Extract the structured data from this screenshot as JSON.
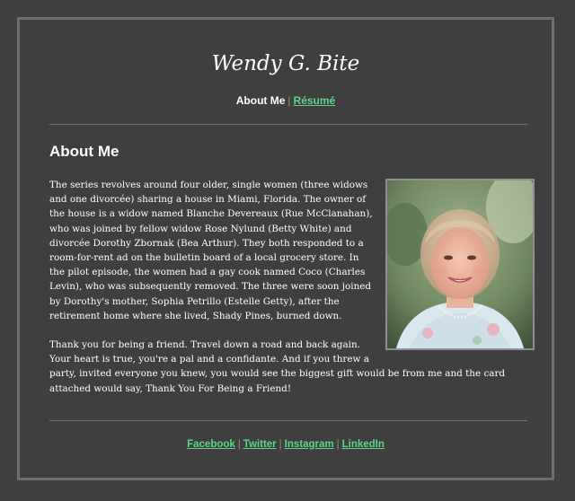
{
  "site": {
    "title": "Wendy G. Bite"
  },
  "nav": {
    "current": "About Me",
    "separator": "|",
    "resume_label": "Résumé"
  },
  "main": {
    "heading": "About Me",
    "paragraph_1": "The series revolves around four older, single women (three widows and one divorcée) sharing a house in Miami, Florida. The owner of the house is a widow named Blanche Devereaux (Rue McClanahan), who was joined by fellow widow Rose Nylund (Betty White) and divorcée Dorothy Zbornak (Bea Arthur). They both responded to a room-for-rent ad on the bulletin board of a local grocery store. In the pilot episode, the women had a gay cook named Coco (Charles Levin), who was subsequently removed. The three were soon joined by Dorothy's mother, Sophia Petrillo (Estelle Getty), after the retirement home where she lived, Shady Pines, burned down.",
    "paragraph_2": "Thank you for being a friend. Travel down a road and back again. Your heart is true, you're a pal and a confidante. And if you threw a party, invited everyone you knew, you would see the biggest gift would be from me and the card attached would say, Thank You For Being a Friend!"
  },
  "footer": {
    "links": [
      "Facebook",
      "Twitter",
      "Instagram",
      "LinkedIn"
    ],
    "separator": "|"
  },
  "colors": {
    "background": "#3f3f3f",
    "frame_border": "#6e6e6e",
    "link": "#5fd48b",
    "text": "#ffffff"
  }
}
